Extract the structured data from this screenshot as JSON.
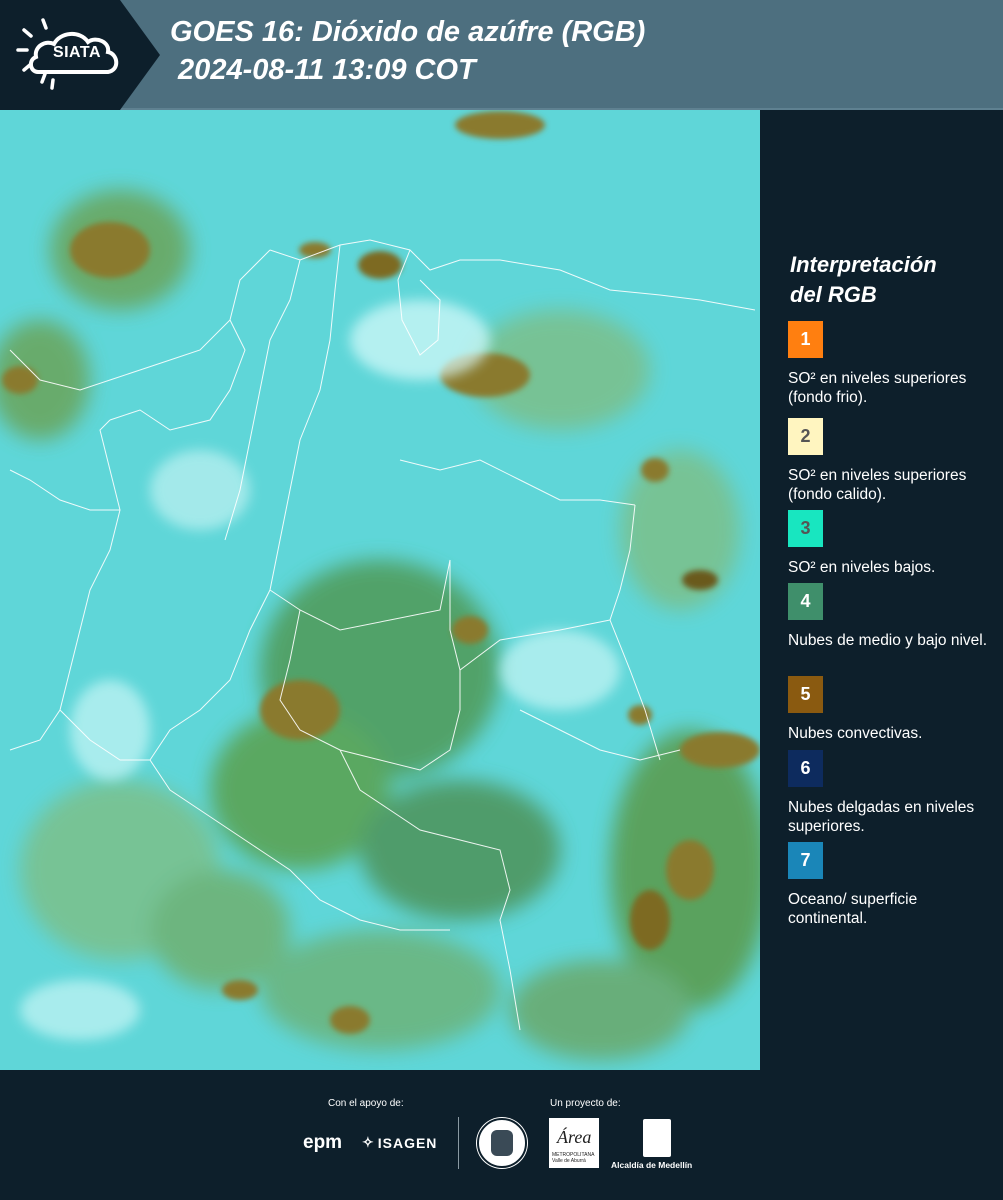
{
  "header": {
    "logo_text": "SIATA",
    "title_line1": "GOES 16: Dióxido de azúfre (RGB)",
    "title_line2": " 2024-08-11 13:09 COT",
    "background_color": "#4d6f7f"
  },
  "map": {
    "description_icon": "satellite-map",
    "base_color": "#5fd6d8",
    "cloud_green_color": "#5e9a4a",
    "cloud_brown_color": "#8a7a2e",
    "border_color": "#ffffff"
  },
  "legend": {
    "title_line1": "Interpretación",
    "title_line2": "del RGB",
    "items": [
      {
        "number": "1",
        "color": "#ff7f10",
        "number_color": "#ffffff",
        "label": "SO² en niveles superiores (fondo frio)."
      },
      {
        "number": "2",
        "color": "#fff5c0",
        "number_color": "#555555",
        "label": "SO² en niveles superiores (fondo calido)."
      },
      {
        "number": "3",
        "color": "#18e6c0",
        "number_color": "#555555",
        "label": "SO² en niveles bajos."
      },
      {
        "number": "4",
        "color": "#3f8f6b",
        "number_color": "#ffffff",
        "label": "Nubes de medio y bajo nivel."
      },
      {
        "number": "5",
        "color": "#8a5a10",
        "number_color": "#ffffff",
        "label": "Nubes convectivas."
      },
      {
        "number": "6",
        "color": "#0d2b5e",
        "number_color": "#ffffff",
        "label": "Nubes delgadas en niveles superiores."
      },
      {
        "number": "7",
        "color": "#1a86b8",
        "number_color": "#ffffff",
        "label": "Oceano/ superficie continental."
      }
    ]
  },
  "footer": {
    "support_label": "Con el apoyo de:",
    "project_label": "Un proyecto de:",
    "epm_text": "epm",
    "isagen_text": "ISAGEN",
    "area_text": "Área",
    "area_subtext": "METROPOLITANA Valle de Aburrá",
    "alcaldia_text": "Alcaldía de Medellín"
  }
}
